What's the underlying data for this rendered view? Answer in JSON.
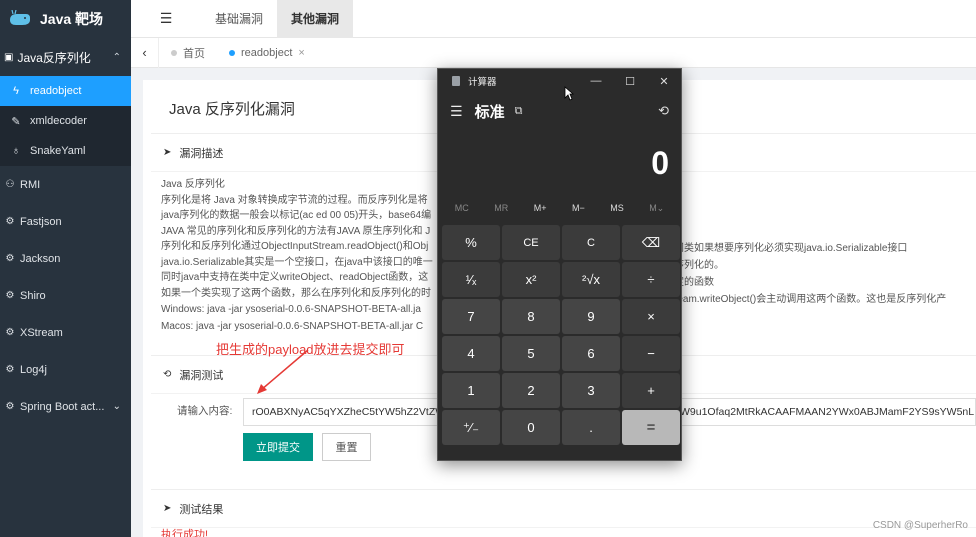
{
  "app": {
    "title": "Java 靶场"
  },
  "sidebar": {
    "group": {
      "label": "Java反序列化",
      "chevron": "chevron-up"
    },
    "subitems": [
      {
        "label": "readobject",
        "icon": "bolt-icon",
        "active": true
      },
      {
        "label": "xmldecoder",
        "icon": "wrench-icon"
      },
      {
        "label": "SnakeYaml",
        "icon": "bulb-icon"
      }
    ],
    "items": [
      {
        "label": "RMI",
        "icon": "users-icon"
      },
      {
        "label": "Fastjson",
        "icon": "gear-icon"
      },
      {
        "label": "Jackson",
        "icon": "gear-icon"
      },
      {
        "label": "Shiro",
        "icon": "gear-icon"
      },
      {
        "label": "XStream",
        "icon": "gear-icon"
      },
      {
        "label": "Log4j",
        "icon": "gear-icon"
      },
      {
        "label": "Spring Boot act...",
        "icon": "gear-icon",
        "chevron": "chevron-down"
      }
    ]
  },
  "header": {
    "tabs": [
      {
        "label": "基础漏洞"
      },
      {
        "label": "其他漏洞",
        "active": true
      }
    ]
  },
  "pagetabs": [
    {
      "label": "首页"
    },
    {
      "label": "readobject",
      "active": true,
      "close": "×"
    }
  ],
  "main": {
    "title": "Java 反序列化漏洞",
    "desc_card": {
      "heading": "漏洞描述",
      "lines": [
        "Java 反序列化",
        "序列化是将 Java 对象转换成字节流的过程。而反序列化是将",
        "java序列化的数据一般会以标记(ac ed 00 05)开头，base64编",
        "JAVA 常见的序列化和反序列化的方法有JAVA 原生序列化和 J",
        "序列化和反序列化通过ObjectInputStream.readObject()和Obj",
        "java.io.Serializable其实是一个空接口，在java中该接口的唯一",
        "同时java中支持在类中定义writeObject、readObject函数，这",
        "如果一个类实现了这两个函数，那么在序列化和反序列化的时",
        "Windows:   java -jar ysoserial-0.0.6-SNAPSHOT-BETA-all.ja",
        "Macos:   java -jar ysoserial-0.0.6-SNAPSHOT-BETA-all.jar C"
      ],
      "right_fragments": [
        "问类如果想要序列化必须实现java.io.Serializable接口",
        "序列化的。",
        "定的函数",
        "ream.writeObject()会主动调用这两个函数。这也是反序列化产"
      ]
    },
    "test_card": {
      "heading": "漏洞测试",
      "label": "请输入内容:",
      "input_value": "rO0ABXNyAC5qYXZheC5tYW5hZ2VtZW",
      "input_value_tail": "W9u1Ofaq2MtRkACAAFMAAN2YWx0ABJMamF2YS9sYW5nL",
      "submit_label": "立即提交",
      "reset_label": "重置"
    },
    "annotation": "把生成的payload放进去提交即可",
    "result_card": {
      "heading": "测试结果",
      "text": "执行成功!"
    }
  },
  "watermark": "CSDN @SuperherRo",
  "calculator": {
    "title": "计算器",
    "mode": "标准",
    "display": "0",
    "memory": [
      "MC",
      "MR",
      "M+",
      "M−",
      "MS",
      "M⌄"
    ],
    "keys": [
      "%",
      "CE",
      "C",
      "⌫",
      "¹⁄ₓ",
      "x²",
      "²√x",
      "÷",
      "7",
      "8",
      "9",
      "×",
      "4",
      "5",
      "6",
      "−",
      "1",
      "2",
      "3",
      "+",
      "⁺⁄₋",
      "0",
      ".",
      "="
    ],
    "colors": {
      "body": "#2b2b2b",
      "key": "#3b3b3b",
      "numkey": "#454545",
      "equals": "#b8b8b8"
    }
  },
  "colors": {
    "sidebar": "#28333e",
    "active": "#1e9fff",
    "submit": "#009688",
    "annotation": "#e53935"
  }
}
